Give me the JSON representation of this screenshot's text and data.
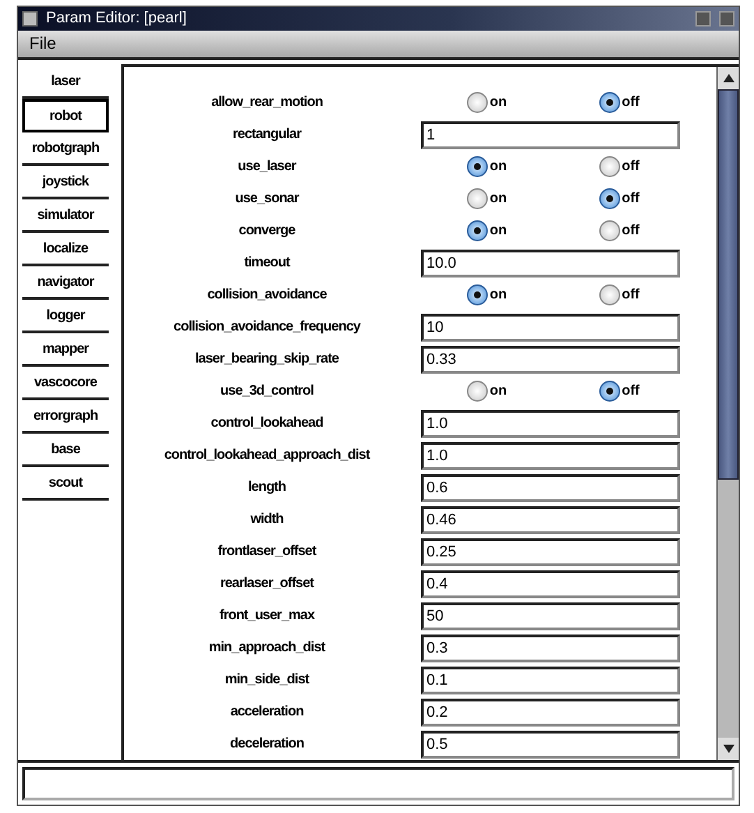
{
  "window": {
    "title": "Param Editor: [pearl]"
  },
  "menu": [
    "File"
  ],
  "tabs": [
    {
      "label": "laser",
      "selected": false
    },
    {
      "label": "robot",
      "selected": true
    },
    {
      "label": "robotgraph",
      "selected": false
    },
    {
      "label": "joystick",
      "selected": false
    },
    {
      "label": "simulator",
      "selected": false
    },
    {
      "label": "localize",
      "selected": false
    },
    {
      "label": "navigator",
      "selected": false
    },
    {
      "label": "logger",
      "selected": false
    },
    {
      "label": "mapper",
      "selected": false
    },
    {
      "label": "vascocore",
      "selected": false
    },
    {
      "label": "errorgraph",
      "selected": false
    },
    {
      "label": "base",
      "selected": false
    },
    {
      "label": "scout",
      "selected": false
    }
  ],
  "params": [
    {
      "name": "allow_rear_motion",
      "kind": "radio",
      "options": [
        {
          "label": "on",
          "selected": false
        },
        {
          "label": "off",
          "selected": true
        }
      ]
    },
    {
      "name": "rectangular",
      "kind": "text",
      "value": "1"
    },
    {
      "name": "use_laser",
      "kind": "radio",
      "options": [
        {
          "label": "on",
          "selected": true
        },
        {
          "label": "off",
          "selected": false
        }
      ]
    },
    {
      "name": "use_sonar",
      "kind": "radio",
      "options": [
        {
          "label": "on",
          "selected": false
        },
        {
          "label": "off",
          "selected": true
        }
      ]
    },
    {
      "name": "converge",
      "kind": "radio",
      "options": [
        {
          "label": "on",
          "selected": true
        },
        {
          "label": "off",
          "selected": false
        }
      ]
    },
    {
      "name": "timeout",
      "kind": "text",
      "value": "10.0"
    },
    {
      "name": "collision_avoidance",
      "kind": "radio",
      "options": [
        {
          "label": "on",
          "selected": true
        },
        {
          "label": "off",
          "selected": false
        }
      ]
    },
    {
      "name": "collision_avoidance_frequency",
      "kind": "text",
      "value": "10"
    },
    {
      "name": "laser_bearing_skip_rate",
      "kind": "text",
      "value": "0.33"
    },
    {
      "name": "use_3d_control",
      "kind": "radio",
      "options": [
        {
          "label": "on",
          "selected": false
        },
        {
          "label": "off",
          "selected": true
        }
      ]
    },
    {
      "name": "control_lookahead",
      "kind": "text",
      "value": "1.0"
    },
    {
      "name": "control_lookahead_approach_dist",
      "kind": "text",
      "value": "1.0"
    },
    {
      "name": "length",
      "kind": "text",
      "value": "0.6"
    },
    {
      "name": "width",
      "kind": "text",
      "value": "0.46"
    },
    {
      "name": "frontlaser_offset",
      "kind": "text",
      "value": "0.25"
    },
    {
      "name": "rearlaser_offset",
      "kind": "text",
      "value": "0.4"
    },
    {
      "name": "front_user_max",
      "kind": "text",
      "value": "50"
    },
    {
      "name": "min_approach_dist",
      "kind": "text",
      "value": "0.3"
    },
    {
      "name": "min_side_dist",
      "kind": "text",
      "value": "0.1"
    },
    {
      "name": "acceleration",
      "kind": "text",
      "value": "0.2"
    },
    {
      "name": "deceleration",
      "kind": "text",
      "value": "0.5"
    }
  ]
}
